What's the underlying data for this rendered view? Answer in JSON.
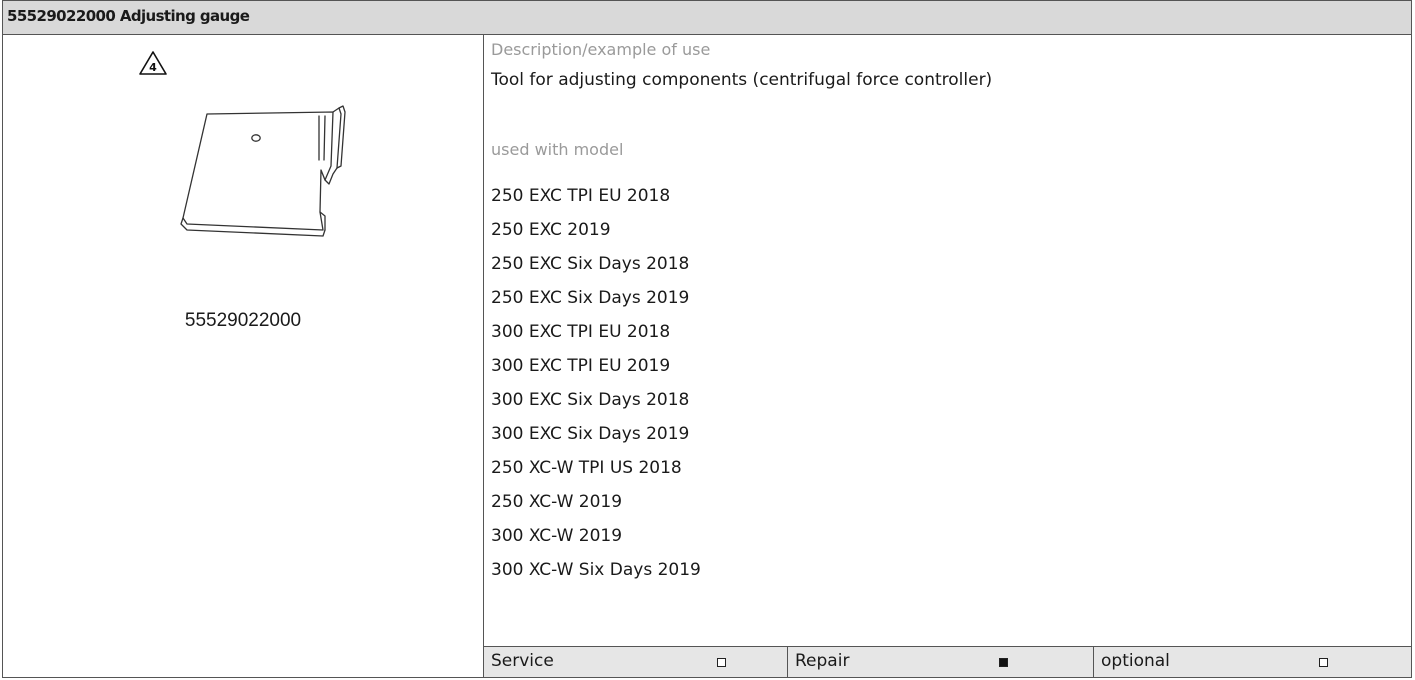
{
  "header": {
    "title": "55529022000 Adjusting gauge"
  },
  "illustration": {
    "warning_number": "4",
    "part_number": "55529022000"
  },
  "description": {
    "label": "Description/example of use",
    "text": "Tool for adjusting components (centrifugal force controller)"
  },
  "models": {
    "label": "used with model",
    "items": [
      "250 EXC TPI EU 2018",
      "250 EXC 2019",
      "250 EXC Six Days 2018",
      "250 EXC Six Days 2019",
      "300 EXC TPI EU 2018",
      "300 EXC TPI EU 2019",
      "300 EXC Six Days 2018",
      "300 EXC Six Days 2019",
      "250 XC-W TPI US 2018",
      "250 XC-W 2019",
      "300 XC-W 2019",
      "300 XC-W Six Days 2019"
    ]
  },
  "categories": [
    {
      "label": "Service",
      "checked": false
    },
    {
      "label": "Repair",
      "checked": true
    },
    {
      "label": "optional",
      "checked": false
    }
  ]
}
